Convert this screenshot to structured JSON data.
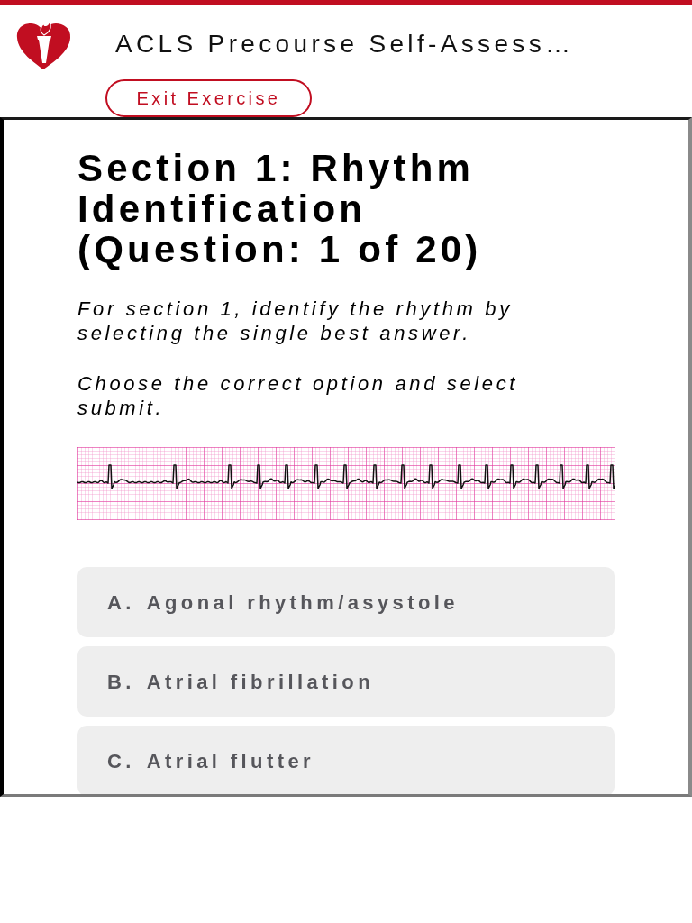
{
  "header": {
    "title": "ACLS Precourse Self-Assess…",
    "exit_button": "Exit Exercise"
  },
  "question": {
    "heading": "Section 1: Rhythm Identification (Question: 1 of 20)",
    "instructions": [
      "For section 1, identify the rhythm by selecting the single best answer.",
      "Choose the correct option and select submit."
    ]
  },
  "options": [
    {
      "letter": "A.",
      "label": "Agonal rhythm/asystole",
      "selected": false
    },
    {
      "letter": "B.",
      "label": "Atrial fibrillation",
      "selected": false
    },
    {
      "letter": "C.",
      "label": "Atrial flutter",
      "selected": false
    }
  ]
}
